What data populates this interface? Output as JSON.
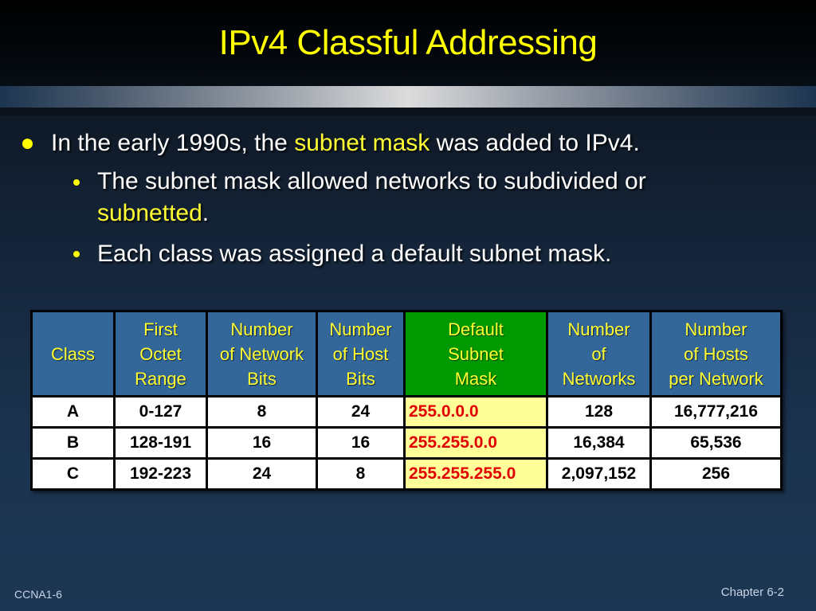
{
  "slide": {
    "title": "IPv4 Classful Addressing",
    "bullets": {
      "main": {
        "before": "In the early 1990s, the ",
        "highlight": "subnet mask",
        "after": " was added to IPv4."
      },
      "sub1": {
        "line1": "The subnet mask allowed networks to subdivided or",
        "highlight": "subnetted",
        "after": "."
      },
      "sub2": {
        "text": "Each class was assigned a default subnet mask."
      }
    },
    "colors": {
      "title": "#ffff00",
      "highlight": "#ffff33",
      "header_bg": "#336699",
      "mask_header_bg": "#009900",
      "mask_cell_bg": "#ffff99",
      "mask_text": "#e00000"
    }
  },
  "table": {
    "headers": [
      [
        "Class"
      ],
      [
        "First",
        "Octet",
        "Range"
      ],
      [
        "Number",
        "of Network",
        "Bits"
      ],
      [
        "Number",
        "of Host",
        "Bits"
      ],
      [
        "Default",
        "Subnet",
        "Mask"
      ],
      [
        "Number",
        "of",
        "Networks"
      ],
      [
        "Number",
        "of Hosts",
        "per Network"
      ]
    ],
    "rows": [
      [
        "A",
        "0-127",
        "8",
        "24",
        "255.0.0.0",
        "128",
        "16,777,216"
      ],
      [
        "B",
        "128-191",
        "16",
        "16",
        "255.255.0.0",
        "16,384",
        "65,536"
      ],
      [
        "C",
        "192-223",
        "24",
        "8",
        "255.255.255.0",
        "2,097,152",
        "256"
      ]
    ]
  },
  "footer": {
    "left": "CCNA1-6",
    "right": "Chapter 6-2"
  }
}
